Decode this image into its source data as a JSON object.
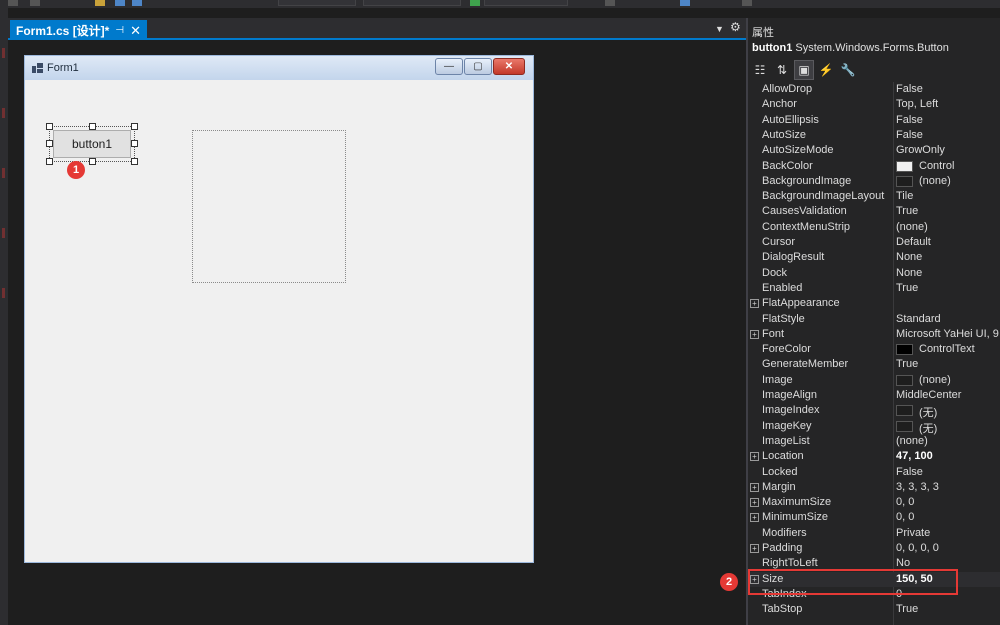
{
  "colors": {
    "accent": "#007acc",
    "marker": "#e53935",
    "highlight_box": "#e53935"
  },
  "document_tab": {
    "label": "Form1.cs [设计]*",
    "pin_icon": "pin-icon",
    "close_icon": "close-icon"
  },
  "form": {
    "title": "Form1",
    "minimize_glyph": "—",
    "maximize_glyph": "▢",
    "close_glyph": "✕",
    "button_label": "button1"
  },
  "markers": [
    "1",
    "2"
  ],
  "properties": {
    "title": "属性",
    "object_name": "button1",
    "object_type": "System.Windows.Forms.Button",
    "toolbar_icons": [
      "categorized-icon",
      "alphabetical-icon",
      "properties-icon",
      "events-icon",
      "property-pages-icon"
    ],
    "rows": [
      {
        "name": "AllowDrop",
        "value": "False"
      },
      {
        "name": "Anchor",
        "value": "Top, Left"
      },
      {
        "name": "AutoEllipsis",
        "value": "False"
      },
      {
        "name": "AutoSize",
        "value": "False"
      },
      {
        "name": "AutoSizeMode",
        "value": "GrowOnly"
      },
      {
        "name": "BackColor",
        "value": "Control",
        "swatch": "#f0f0f0"
      },
      {
        "name": "BackgroundImage",
        "value": "(none)",
        "swatch": "#1e1e1e"
      },
      {
        "name": "BackgroundImageLayout",
        "value": "Tile"
      },
      {
        "name": "CausesValidation",
        "value": "True"
      },
      {
        "name": "ContextMenuStrip",
        "value": "(none)"
      },
      {
        "name": "Cursor",
        "value": "Default"
      },
      {
        "name": "DialogResult",
        "value": "None"
      },
      {
        "name": "Dock",
        "value": "None"
      },
      {
        "name": "Enabled",
        "value": "True"
      },
      {
        "name": "FlatAppearance",
        "value": "",
        "expandable": true
      },
      {
        "name": "FlatStyle",
        "value": "Standard"
      },
      {
        "name": "Font",
        "value": "Microsoft YaHei UI, 9",
        "expandable": true
      },
      {
        "name": "ForeColor",
        "value": "ControlText",
        "swatch": "#000000"
      },
      {
        "name": "GenerateMember",
        "value": "True"
      },
      {
        "name": "Image",
        "value": "(none)",
        "swatch": "#1e1e1e"
      },
      {
        "name": "ImageAlign",
        "value": "MiddleCenter"
      },
      {
        "name": "ImageIndex",
        "value": "(无)",
        "swatch": "#1e1e1e"
      },
      {
        "name": "ImageKey",
        "value": "(无)",
        "swatch": "#1e1e1e"
      },
      {
        "name": "ImageList",
        "value": "(none)"
      },
      {
        "name": "Location",
        "value": "47, 100",
        "expandable": true,
        "bold": true
      },
      {
        "name": "Locked",
        "value": "False"
      },
      {
        "name": "Margin",
        "value": "3, 3, 3, 3",
        "expandable": true
      },
      {
        "name": "MaximumSize",
        "value": "0, 0",
        "expandable": true
      },
      {
        "name": "MinimumSize",
        "value": "0, 0",
        "expandable": true
      },
      {
        "name": "Modifiers",
        "value": "Private"
      },
      {
        "name": "Padding",
        "value": "0, 0, 0, 0",
        "expandable": true
      },
      {
        "name": "RightToLeft",
        "value": "No"
      },
      {
        "name": "Size",
        "value": "150, 50",
        "expandable": true,
        "bold": true,
        "highlighted": true
      },
      {
        "name": "TabIndex",
        "value": "0"
      },
      {
        "name": "TabStop",
        "value": "True"
      }
    ]
  }
}
